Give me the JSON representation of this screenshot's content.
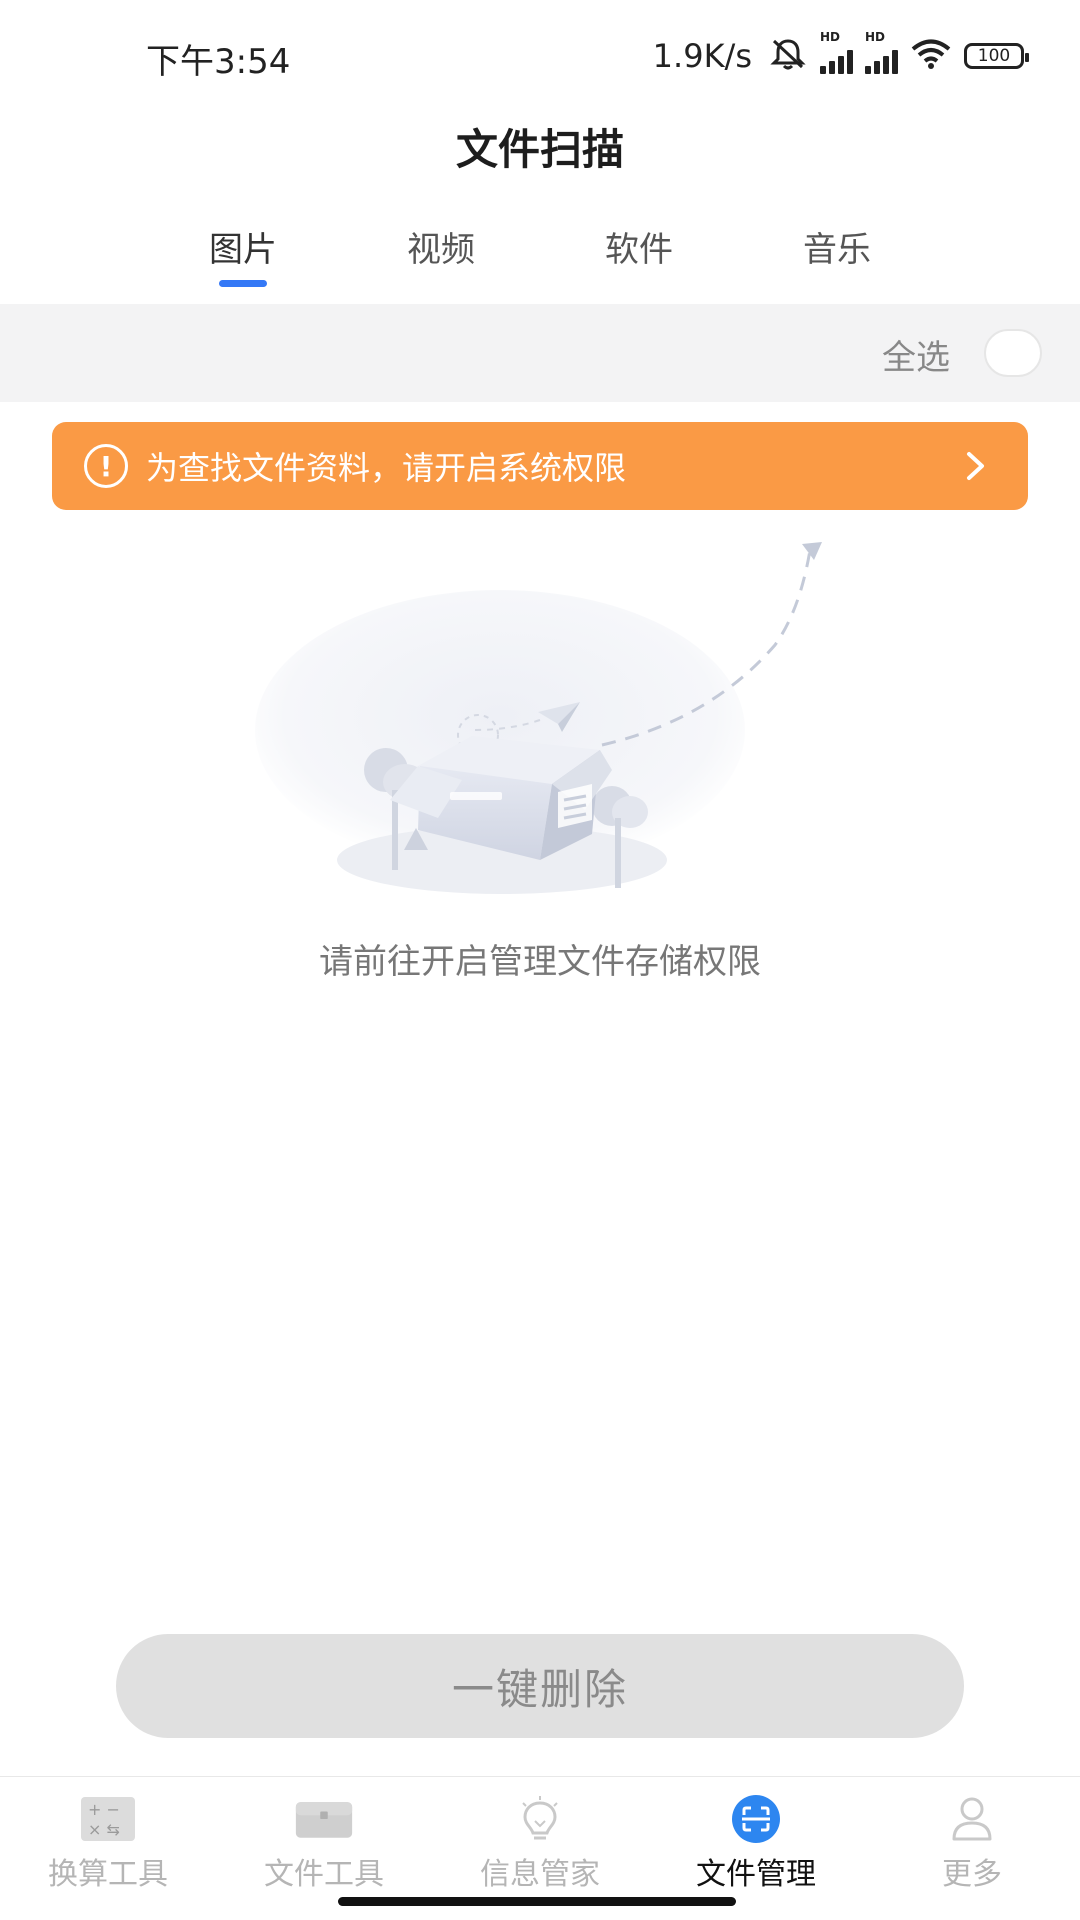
{
  "status_bar": {
    "time": "下午3:54",
    "net_speed": "1.9K/s",
    "battery": "100",
    "sim1_label": "HD",
    "sim2_label": "HD"
  },
  "header": {
    "title": "文件扫描"
  },
  "tabs": [
    {
      "label": "图片",
      "active": true
    },
    {
      "label": "视频",
      "active": false
    },
    {
      "label": "软件",
      "active": false
    },
    {
      "label": "音乐",
      "active": false
    }
  ],
  "select_all": {
    "label": "全选",
    "checked": false
  },
  "permission_banner": {
    "text": "为查找文件资料，请开启系统权限",
    "icon": "exclamation-circle-icon",
    "color": "#fa9a45"
  },
  "empty_state": {
    "message": "请前往开启管理文件存储权限"
  },
  "delete_button": {
    "label": "一键删除"
  },
  "bottom_nav": [
    {
      "label": "换算工具",
      "icon": "calculator-icon",
      "active": false
    },
    {
      "label": "文件工具",
      "icon": "toolbox-icon",
      "active": false
    },
    {
      "label": "信息管家",
      "icon": "lightbulb-icon",
      "active": false
    },
    {
      "label": "文件管理",
      "icon": "scan-icon",
      "active": true
    },
    {
      "label": "更多",
      "icon": "person-icon",
      "active": false
    }
  ],
  "colors": {
    "accent": "#3478f6",
    "banner": "#fa9a45",
    "inactive": "#b5b5b5"
  }
}
